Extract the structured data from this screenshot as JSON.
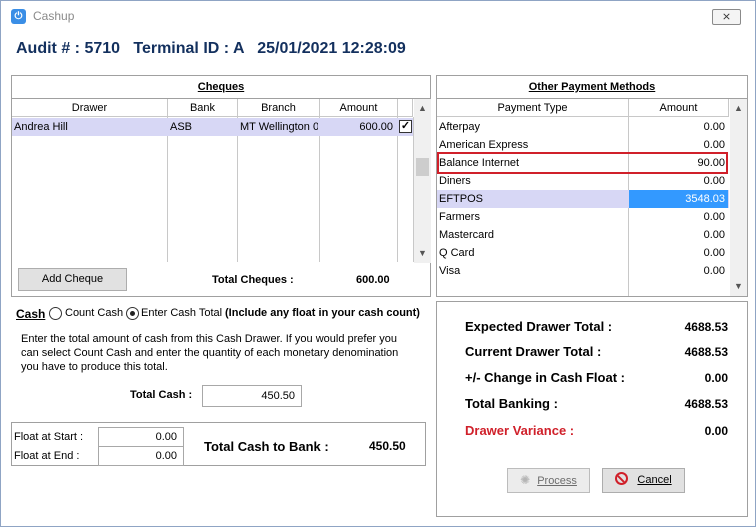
{
  "window": {
    "title": "Cashup",
    "close_label": "⨯"
  },
  "header": {
    "audit_text": "Audit # : 5710   Terminal ID : A   25/01/2021 12:28:09"
  },
  "cheques": {
    "title": "Cheques",
    "columns": [
      "Drawer",
      "Bank",
      "Branch",
      "Amount"
    ],
    "rows": [
      {
        "drawer": "Andrea Hill",
        "bank": "ASB",
        "branch": "MT Wellington 0",
        "amount": "600.00",
        "checked": true
      }
    ],
    "add_label": "Add Cheque",
    "total_label": "Total Cheques :",
    "total_value": "600.00"
  },
  "payments": {
    "title": "Other Payment Methods",
    "columns": [
      "Payment Type",
      "Amount"
    ],
    "rows": [
      {
        "type": "Afterpay",
        "amount": "0.00"
      },
      {
        "type": "American Express",
        "amount": "0.00"
      },
      {
        "type": "Balance Internet",
        "amount": "90.00"
      },
      {
        "type": "Diners",
        "amount": "0.00"
      },
      {
        "type": "EFTPOS",
        "amount": "3548.03"
      },
      {
        "type": "Farmers",
        "amount": "0.00"
      },
      {
        "type": "Mastercard",
        "amount": "0.00"
      },
      {
        "type": "Q Card",
        "amount": "0.00"
      },
      {
        "type": "Visa",
        "amount": "0.00"
      }
    ]
  },
  "cash": {
    "label": "Cash",
    "count_cash": "Count Cash",
    "enter_total": "Enter Cash Total",
    "include_note": "(Include any float in your cash count)",
    "instructions": [
      "Enter the total amount of cash from this Cash Drawer.  If you would prefer you",
      "can select Count Cash and enter the quantity of each monetary denomination",
      "you have to produce this total."
    ],
    "total_cash_label": "Total Cash :",
    "total_cash_value": "450.50",
    "float_start_label": "Float at Start :",
    "float_start_value": "0.00",
    "float_end_label": "Float at End :",
    "float_end_value": "0.00",
    "total_bank_label": "Total Cash to Bank :",
    "total_bank_value": "450.50"
  },
  "summary": {
    "expected_label": "Expected Drawer Total :",
    "expected_value": "4688.53",
    "current_label": "Current Drawer Total :",
    "current_value": "4688.53",
    "change_label": "+/- Change in Cash Float :",
    "change_value": "0.00",
    "banking_label": "Total Banking :",
    "banking_value": "4688.53",
    "variance_label": "Drawer Variance :",
    "variance_value": "0.00",
    "variance_color": "#d0202a"
  },
  "actions": {
    "process_label": "Process",
    "cancel_label": "Cancel"
  }
}
